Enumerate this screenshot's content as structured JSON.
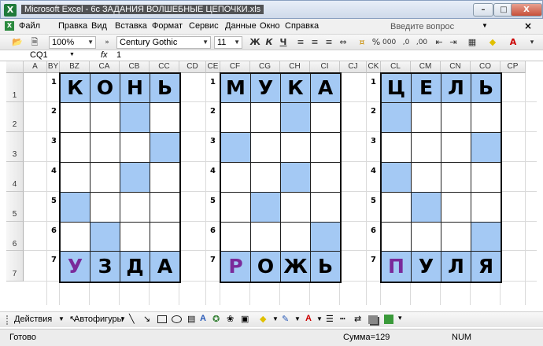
{
  "window": {
    "title": "Microsoft Excel - 6с ЗАДАНИЯ ВОЛШЕБНЫЕ ЦЕПОЧКИ.xls",
    "app_icon": "excel-icon",
    "minimize": "–",
    "maximize": "□",
    "close": "X"
  },
  "menu": {
    "items": [
      "Файл",
      "Правка",
      "Вид",
      "Вставка",
      "Формат",
      "Сервис",
      "Данные",
      "Окно",
      "Справка"
    ],
    "help_placeholder": "Введите вопрос",
    "doc_close": "×"
  },
  "toolbar": {
    "zoom": "100%",
    "font": "Century Gothic",
    "font_size": "11",
    "bold": "Ж",
    "italic": "К",
    "underline": "Ч",
    "percent": "%",
    "thousands": "000",
    "inc_decimal": ",0",
    "dec_decimal": ",00"
  },
  "formula_bar": {
    "name_box": "CQ1",
    "fx": "fx",
    "value": "1"
  },
  "sheet": {
    "columns": [
      "A",
      "BY",
      "BZ",
      "CA",
      "CB",
      "CC",
      "CD",
      "CE",
      "CF",
      "CG",
      "CH",
      "CI",
      "CJ",
      "CK",
      "CL",
      "CM",
      "CN",
      "CO",
      "CP"
    ],
    "rows": [
      "1",
      "2",
      "3",
      "4",
      "5",
      "6",
      "7"
    ],
    "numbers": [
      "1",
      "2",
      "3",
      "4",
      "5",
      "6",
      "7"
    ],
    "puzzles": [
      {
        "top": [
          "К",
          "О",
          "Н",
          "Ь"
        ],
        "bottom": [
          "У",
          "З",
          "Д",
          "А"
        ],
        "blue": [
          [
            2,
            2
          ],
          [
            3,
            3
          ],
          [
            4,
            2
          ],
          [
            5,
            0
          ],
          [
            6,
            1
          ]
        ]
      },
      {
        "top": [
          "М",
          "У",
          "К",
          "А"
        ],
        "bottom": [
          "Р",
          "О",
          "Ж",
          "Ь"
        ],
        "blue": [
          [
            2,
            2
          ],
          [
            3,
            0
          ],
          [
            4,
            2
          ],
          [
            5,
            1
          ],
          [
            6,
            3
          ]
        ]
      },
      {
        "top": [
          "Ц",
          "Е",
          "Л",
          "Ь"
        ],
        "bottom": [
          "П",
          "У",
          "Л",
          "Я"
        ],
        "blue": [
          [
            2,
            0
          ],
          [
            3,
            3
          ],
          [
            4,
            0
          ],
          [
            5,
            1
          ],
          [
            6,
            3
          ]
        ]
      }
    ]
  },
  "drawing": {
    "actions": "Действия",
    "autoshapes": "Автофигуры"
  },
  "status": {
    "ready": "Готово",
    "sum": "Сумма=129",
    "num": "NUM"
  }
}
